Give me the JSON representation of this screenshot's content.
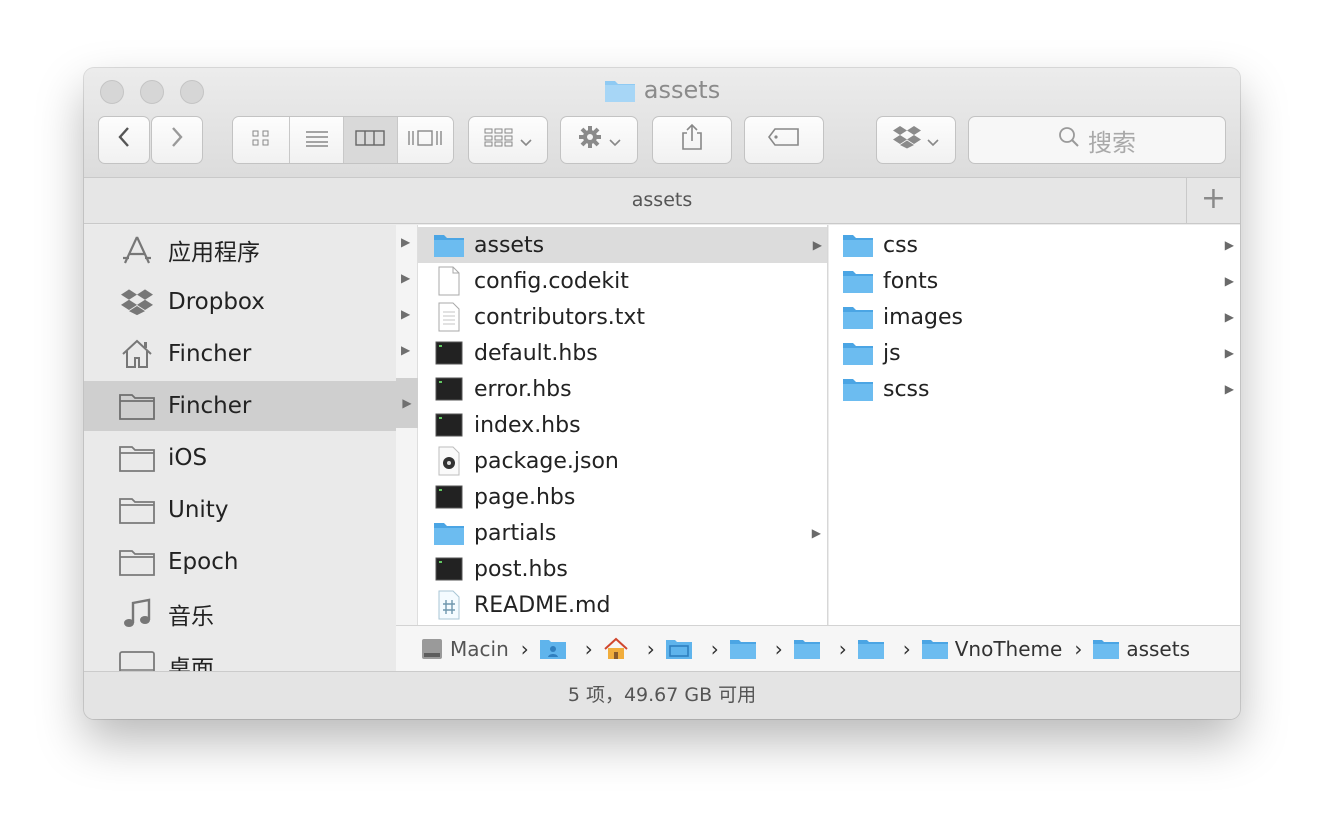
{
  "window": {
    "title": "assets",
    "tab_title": "assets"
  },
  "toolbar": {
    "back_icon": "chevron-left-icon",
    "forward_icon": "chevron-right-icon",
    "view_icons": [
      "icon-view-icon",
      "list-view-icon",
      "column-view-icon",
      "cover-flow-icon"
    ],
    "active_view": "column-view",
    "search_placeholder": "搜索"
  },
  "sidebar": {
    "items": [
      {
        "label": "应用程序",
        "icon": "applications-icon"
      },
      {
        "label": "Dropbox",
        "icon": "dropbox-icon"
      },
      {
        "label": "Fincher",
        "icon": "home-icon"
      },
      {
        "label": "Fincher",
        "icon": "folder-icon",
        "selected": true
      },
      {
        "label": "iOS",
        "icon": "folder-icon"
      },
      {
        "label": "Unity",
        "icon": "folder-icon"
      },
      {
        "label": "Epoch",
        "icon": "folder-icon"
      },
      {
        "label": "音乐",
        "icon": "music-icon"
      },
      {
        "label": "桌面",
        "icon": "desktop-icon"
      }
    ]
  },
  "column1": {
    "items": [
      {
        "name": "assets",
        "kind": "folder",
        "has_children": true,
        "selected": true
      },
      {
        "name": "config.codekit",
        "kind": "blank",
        "has_children": false
      },
      {
        "name": "contributors.txt",
        "kind": "text",
        "has_children": false
      },
      {
        "name": "default.hbs",
        "kind": "terminal",
        "has_children": false
      },
      {
        "name": "error.hbs",
        "kind": "terminal",
        "has_children": false
      },
      {
        "name": "index.hbs",
        "kind": "terminal",
        "has_children": false
      },
      {
        "name": "package.json",
        "kind": "json",
        "has_children": false
      },
      {
        "name": "page.hbs",
        "kind": "terminal",
        "has_children": false
      },
      {
        "name": "partials",
        "kind": "folder",
        "has_children": true
      },
      {
        "name": "post.hbs",
        "kind": "terminal",
        "has_children": false
      },
      {
        "name": "README.md",
        "kind": "markdown",
        "has_children": false
      }
    ]
  },
  "column2": {
    "items": [
      {
        "name": "css",
        "kind": "folder"
      },
      {
        "name": "fonts",
        "kind": "folder"
      },
      {
        "name": "images",
        "kind": "folder"
      },
      {
        "name": "js",
        "kind": "folder"
      },
      {
        "name": "scss",
        "kind": "folder"
      }
    ]
  },
  "pathbar": {
    "segments": [
      {
        "label": "Macin",
        "icon": "hard-drive-icon"
      },
      {
        "label": "",
        "icon": "user-folder-icon"
      },
      {
        "label": "",
        "icon": "home-icon"
      },
      {
        "label": "",
        "icon": "folder-icon"
      },
      {
        "label": "",
        "icon": "folder-icon"
      },
      {
        "label": "",
        "icon": "folder-icon"
      },
      {
        "label": "",
        "icon": "folder-icon"
      },
      {
        "label": "VnoTheme",
        "icon": "folder-icon"
      },
      {
        "label": "assets",
        "icon": "folder-icon"
      }
    ]
  },
  "status": {
    "text": "5 项，49.67 GB 可用"
  },
  "colors": {
    "folder_blue": "#5fb4ec",
    "selection_gray": "#cfcfcf",
    "window_bg": "#ececec"
  }
}
